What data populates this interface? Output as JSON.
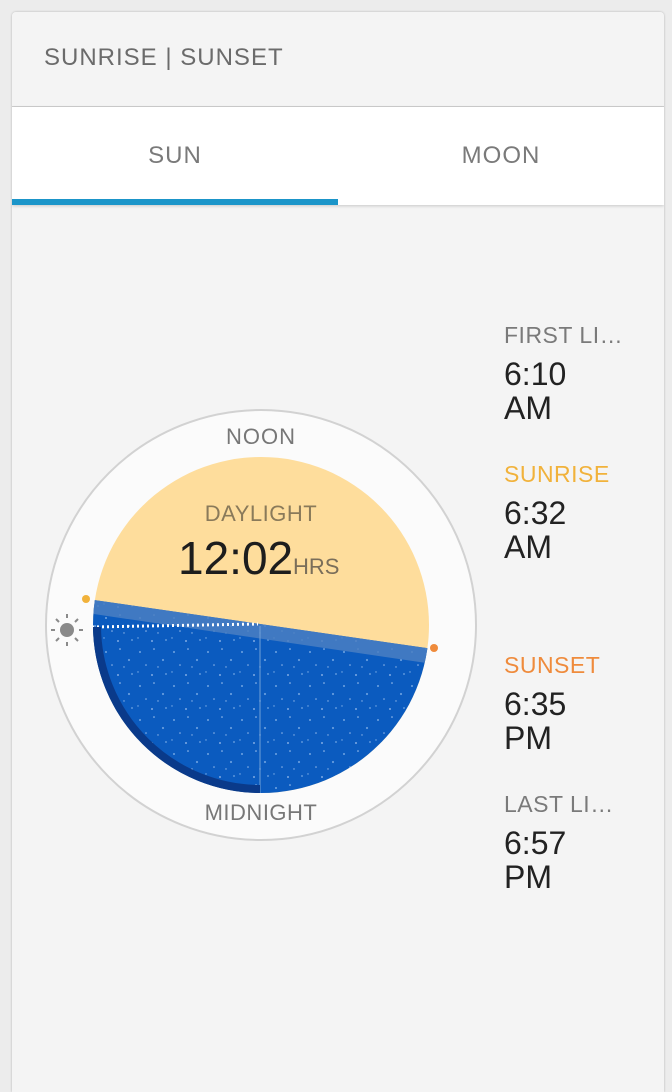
{
  "header": {
    "title": "SUNRISE | SUNSET"
  },
  "tabs": [
    {
      "label": "SUN",
      "selected": true
    },
    {
      "label": "MOON",
      "selected": false
    }
  ],
  "dial": {
    "noon_label": "NOON",
    "midnight_label": "MIDNIGHT",
    "daylight_label": "DAYLIGHT",
    "daylight_value": "12:02",
    "daylight_unit": "HRS"
  },
  "times": {
    "first_light": {
      "label": "FIRST LIGHT",
      "time": "6:10",
      "ampm": "AM"
    },
    "sunrise": {
      "label": "SUNRISE",
      "time": "6:32",
      "ampm": "AM"
    },
    "sunset": {
      "label": "SUNSET",
      "time": "6:35",
      "ampm": "PM"
    },
    "last_light": {
      "label": "LAST LIGHT",
      "time": "6:57",
      "ampm": "PM"
    }
  },
  "colors": {
    "accent": "#1b95c9",
    "daylight": "#fedd9c",
    "night": "#0b5bbf",
    "sunrise": "#f1b23b",
    "sunset": "#ef8b3c"
  },
  "icons": {
    "current_sun": "sun-icon"
  }
}
